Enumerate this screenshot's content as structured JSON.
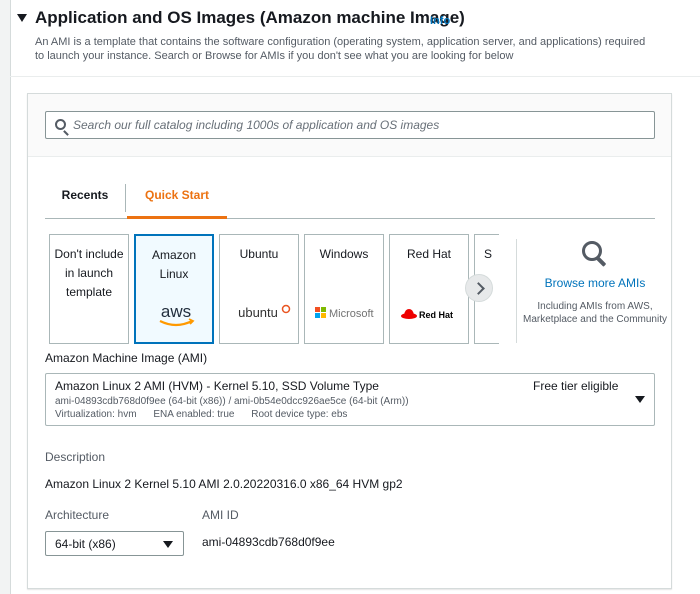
{
  "section": {
    "title": "Application and OS Images (Amazon machine Image)",
    "info_label": "Info",
    "description": "An AMI is a template that contains the software configuration (operating system, application server, and applications) required to launch your instance. Search or Browse for AMIs if you don't see what you are looking for below"
  },
  "search": {
    "placeholder": "Search our full catalog including 1000s of application and OS images"
  },
  "tabs": [
    {
      "label": "Recents",
      "active": false
    },
    {
      "label": "Quick Start",
      "active": true
    }
  ],
  "cards": [
    {
      "label": "Don't include in launch template",
      "logo": "",
      "selected": false
    },
    {
      "label": "Amazon Linux",
      "logo": "aws",
      "selected": true
    },
    {
      "label": "Ubuntu",
      "logo": "ubuntu",
      "selected": false
    },
    {
      "label": "Windows",
      "logo": "Microsoft",
      "selected": false
    },
    {
      "label": "Red Hat",
      "logo": "Red Hat",
      "selected": false
    },
    {
      "label": "S",
      "logo": "",
      "selected": false
    }
  ],
  "browse": {
    "link": "Browse more AMIs",
    "sub": "Including AMIs from AWS, Marketplace and the Community"
  },
  "ami": {
    "label": "Amazon Machine Image (AMI)",
    "name": "Amazon Linux 2 AMI (HVM) - Kernel 5.10, SSD Volume Type",
    "tier": "Free tier eligible",
    "ids": "ami-04893cdb768d0f9ee (64-bit (x86)) / ami-0b54e0dcc926ae5ce (64-bit (Arm))",
    "virtualization": "Virtualization: hvm",
    "ena": "ENA enabled: true",
    "root_device": "Root device type: ebs"
  },
  "description": {
    "label": "Description",
    "value": "Amazon Linux 2 Kernel 5.10 AMI 2.0.20220316.0 x86_64 HVM gp2"
  },
  "architecture": {
    "label": "Architecture",
    "value": "64-bit (x86)"
  },
  "ami_id": {
    "label": "AMI ID",
    "value": "ami-04893cdb768d0f9ee"
  },
  "colors": {
    "accent": "#ec7211",
    "link": "#0073bb",
    "selected_bg": "#f1faff",
    "redhat": "#ee0000",
    "ubuntu": "#e95420"
  }
}
